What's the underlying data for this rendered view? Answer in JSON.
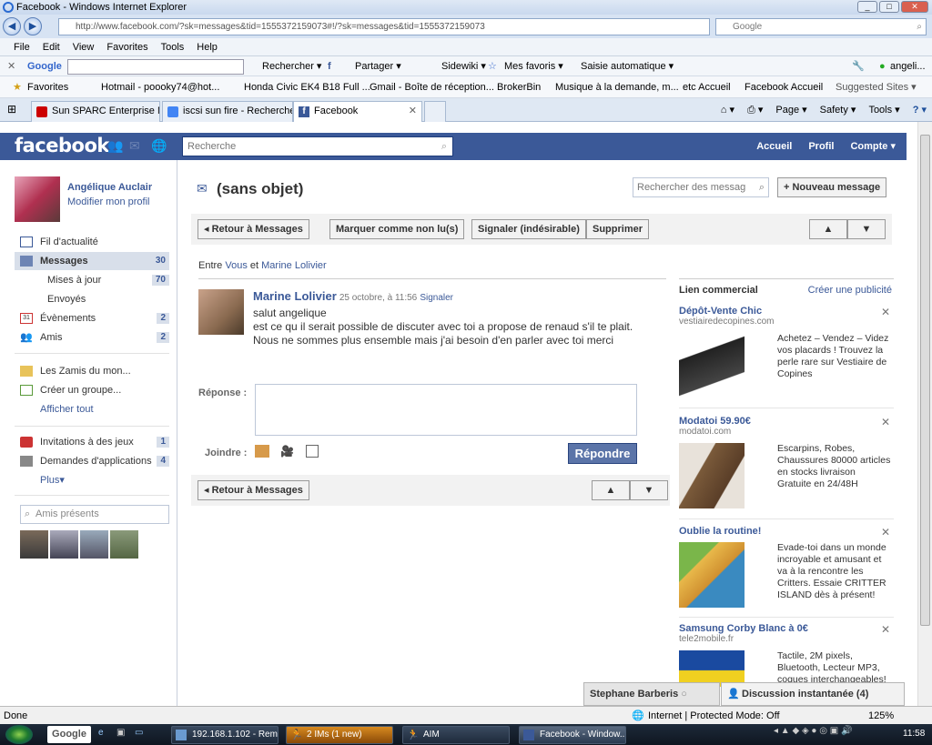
{
  "window": {
    "title": "Facebook - Windows Internet Explorer",
    "min": "_",
    "max": "□",
    "close": "✕"
  },
  "address": {
    "url": "http://www.facebook.com/?sk=messages&tid=1555372159073#!/?sk=messages&tid=1555372159073",
    "search_placeholder": "Google"
  },
  "menu": [
    "File",
    "Edit",
    "View",
    "Favorites",
    "Tools",
    "Help"
  ],
  "google_toolbar": {
    "logo": "Google",
    "items": [
      "Rechercher ▾",
      "Partager ▾",
      "Sidewiki ▾",
      "Mes favoris ▾",
      "Saisie automatique ▾"
    ],
    "account": "angeli..."
  },
  "favorites": {
    "label": "Favorites",
    "items": [
      "Hotmail - poooky74@hot...",
      "Honda Civic EK4 B18 Full ...",
      "Gmail - Boîte de réception...",
      "BrokerBin",
      "Musique à la demande, m...",
      "etc Accueil",
      "Facebook  Accueil",
      "Suggested Sites ▾"
    ]
  },
  "tabs": [
    "Sun SPARC Enterprise M40...",
    "iscsi sun fire - Recherche G...",
    "Facebook"
  ],
  "ie_cmd": [
    "Page ▾",
    "Safety ▾",
    "Tools ▾"
  ],
  "fb": {
    "logo": "facebook",
    "search_placeholder": "Recherche",
    "nav": [
      "Accueil",
      "Profil",
      "Compte ▾"
    ],
    "user": {
      "name": "Angélique Auclair",
      "edit": "Modifier mon profil"
    },
    "left_nav": [
      {
        "label": "Fil d'actualité",
        "count": ""
      },
      {
        "label": "Messages",
        "count": "30"
      },
      {
        "label": "Mises à jour",
        "count": "70"
      },
      {
        "label": "Envoyés",
        "count": ""
      },
      {
        "label": "Évènements",
        "count": "2"
      },
      {
        "label": "Amis",
        "count": "2"
      },
      {
        "label": "Les Zamis du mon...",
        "count": ""
      },
      {
        "label": "Créer un groupe...",
        "count": ""
      },
      {
        "label": "Afficher tout",
        "count": ""
      },
      {
        "label": "Invitations à des jeux",
        "count": "1"
      },
      {
        "label": "Demandes d'applications",
        "count": "4"
      },
      {
        "label": "Plus▾",
        "count": ""
      }
    ],
    "friends_placeholder": "Amis présents",
    "thread": {
      "title": "(sans objet)",
      "search_placeholder": "Rechercher des messag",
      "new_message": "+ Nouveau message",
      "buttons": [
        "◂ Retour à Messages",
        "Marquer comme non lu(s)",
        "Signaler (indésirable)",
        "Supprimer"
      ],
      "participants_prefix": "Entre",
      "participants": [
        "Vous",
        "et",
        "Marine Lolivier"
      ],
      "message": {
        "author": "Marine Lolivier",
        "date": "25 octobre, à 11:56",
        "report": "Signaler",
        "lines": [
          "salut angelique",
          "est ce qu il serait possible de discuter avec toi a propose de renaud s'il te plait. Nous ne sommes plus ensemble mais j'ai besoin d'en parler avec toi merci"
        ]
      },
      "reply_label": "Réponse :",
      "attach_label": "Joindre :",
      "reply_button": "Répondre",
      "back_button": "◂ Retour à Messages"
    },
    "sponsored": {
      "heading": "Lien commercial",
      "create": "Créer une publicité",
      "ads": [
        {
          "title": "Dépôt-Vente Chic",
          "domain": "vestiairedecopines.com",
          "body": "Achetez – Vendez – Videz vos placards ! Trouvez la perle rare sur Vestiaire de Copines"
        },
        {
          "title": "Modatoi 59.90€",
          "domain": "modatoi.com",
          "body": "Escarpins, Robes, Chaussures 80000 articles en stocks livraison Gratuite en 24/48H"
        },
        {
          "title": "Oublie la routine!",
          "domain": "",
          "body": "Evade-toi dans un monde incroyable et amusant et va à la rencontre les Critters. Essaie CRITTER ISLAND dès à présent!"
        },
        {
          "title": "Samsung Corby Blanc à 0€",
          "domain": "tele2mobile.fr",
          "body": "Tactile, 2M pixels, Bluetooth, Lecteur MP3, coques interchangeables!"
        }
      ]
    },
    "chat": {
      "contact": "Stephane Barberis",
      "label": "Discussion instantanée (4)"
    }
  },
  "status": {
    "left": "Done",
    "zone": "Internet | Protected Mode: Off",
    "zoom": "125%"
  },
  "taskbar": {
    "google": "Google",
    "tasks": [
      "192.168.1.102 - Rem...",
      "2 IMs (1 new)",
      "AIM",
      "Facebook - Window..."
    ],
    "time": "11:58"
  }
}
